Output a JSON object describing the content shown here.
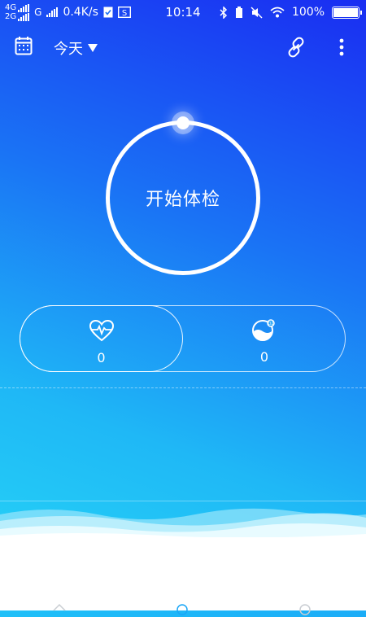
{
  "status_bar": {
    "net_top": "4G",
    "net_bottom": "2G",
    "carrier_g": "G",
    "speed": "0.4K/s",
    "time": "10:14",
    "battery": "100%"
  },
  "top_bar": {
    "date_label": "今天",
    "icons": [
      "calendar-icon",
      "link-icon",
      "more-icon"
    ]
  },
  "center": {
    "start_label": "开始体检"
  },
  "metrics": [
    {
      "icon": "heart-rate-icon",
      "value": "0"
    },
    {
      "icon": "blood-oxygen-icon",
      "value": "0"
    }
  ],
  "bottom_tabs": [
    "home-tab-icon",
    "check-tab-icon",
    "profile-tab-icon"
  ],
  "colors": {
    "gradient_top": "#1a2df2",
    "gradient_bottom": "#27d8f7",
    "foreground": "#ffffff"
  }
}
